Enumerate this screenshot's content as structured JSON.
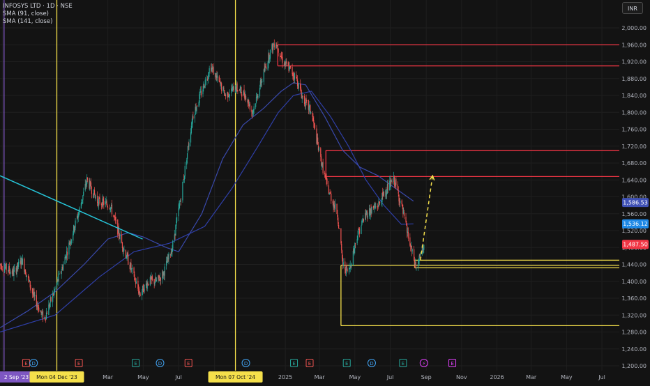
{
  "header": {
    "title": "INFOSYS LTD · 1D · NSE",
    "indicators": [
      "SMA (91, close)",
      "SMA (141, close)"
    ],
    "currency": "INR"
  },
  "colors": {
    "background": "#131313",
    "grid": "#1f1f1f",
    "up": "#26a69a",
    "down": "#ef5350",
    "sma91": "#3949ab",
    "sma141": "#2f3fa8",
    "trendline": "#26c6da",
    "resistance": "#f23645",
    "support": "#f5e04b",
    "vline_yellow": "#f5e04b",
    "vline_purple": "#7e57c2"
  },
  "chart_data": {
    "type": "candlestick",
    "ylim": [
      1190,
      2030
    ],
    "y_ticks": [
      1200,
      1240,
      1280,
      1320,
      1360,
      1400,
      1440,
      1480,
      1520,
      1560,
      1600,
      1640,
      1680,
      1720,
      1760,
      1800,
      1840,
      1880,
      1920,
      1960,
      2000
    ],
    "y_tick_labels": [
      "1,200.00",
      "1,240.00",
      "1,280.00",
      "1,320.00",
      "1,360.00",
      "1,400.00",
      "1,440.00",
      "1,480.00",
      "1,520.00",
      "1,560.00",
      "1,600.00",
      "1,640.00",
      "1,680.00",
      "1,720.00",
      "1,760.00",
      "1,800.00",
      "1,840.00",
      "1,880.00",
      "1,920.00",
      "1,960.00",
      "2,000.00"
    ],
    "x_axis": {
      "start": "2023-08-28",
      "end": "2026-07-31",
      "labels": [
        {
          "date": "2023-09-01",
          "text": "N"
        },
        {
          "date": "2024-03-01",
          "text": "Mar"
        },
        {
          "date": "2024-05-01",
          "text": "May"
        },
        {
          "date": "2024-07-01",
          "text": "Jul"
        },
        {
          "date": "2024-09-01",
          "text": "Se"
        },
        {
          "date": "2025-01-01",
          "text": "2025"
        },
        {
          "date": "2025-03-01",
          "text": "Mar"
        },
        {
          "date": "2025-05-01",
          "text": "May"
        },
        {
          "date": "2025-07-01",
          "text": "Jul"
        },
        {
          "date": "2025-09-01",
          "text": "Sep"
        },
        {
          "date": "2025-11-01",
          "text": "Nov"
        },
        {
          "date": "2026-01-01",
          "text": "2026"
        },
        {
          "date": "2026-03-01",
          "text": "Mar"
        },
        {
          "date": "2026-05-01",
          "text": "May"
        },
        {
          "date": "2026-07-01",
          "text": "Jul"
        }
      ]
    },
    "price_path": [
      [
        "2023-08-28",
        1440
      ],
      [
        "2023-09-20",
        1420
      ],
      [
        "2023-10-05",
        1450
      ],
      [
        "2023-10-26",
        1360
      ],
      [
        "2023-11-12",
        1310
      ],
      [
        "2023-11-28",
        1370
      ],
      [
        "2023-12-15",
        1440
      ],
      [
        "2024-01-10",
        1560
      ],
      [
        "2024-01-25",
        1640
      ],
      [
        "2024-02-12",
        1590
      ],
      [
        "2024-03-05",
        1580
      ],
      [
        "2024-03-25",
        1490
      ],
      [
        "2024-04-10",
        1430
      ],
      [
        "2024-04-25",
        1370
      ],
      [
        "2024-05-10",
        1400
      ],
      [
        "2024-05-25",
        1400
      ],
      [
        "2024-06-05",
        1420
      ],
      [
        "2024-06-20",
        1480
      ],
      [
        "2024-07-05",
        1600
      ],
      [
        "2024-07-25",
        1790
      ],
      [
        "2024-08-10",
        1850
      ],
      [
        "2024-08-25",
        1910
      ],
      [
        "2024-09-05",
        1880
      ],
      [
        "2024-09-20",
        1840
      ],
      [
        "2024-10-07",
        1860
      ],
      [
        "2024-10-25",
        1840
      ],
      [
        "2024-11-05",
        1800
      ],
      [
        "2024-11-20",
        1870
      ],
      [
        "2024-12-05",
        1940
      ],
      [
        "2024-12-15",
        1970
      ],
      [
        "2024-12-28",
        1920
      ],
      [
        "2025-01-10",
        1900
      ],
      [
        "2025-01-20",
        1880
      ],
      [
        "2025-02-01",
        1830
      ],
      [
        "2025-02-15",
        1800
      ],
      [
        "2025-03-01",
        1700
      ],
      [
        "2025-03-15",
        1620
      ],
      [
        "2025-04-01",
        1560
      ],
      [
        "2025-04-10",
        1440
      ],
      [
        "2025-04-20",
        1420
      ],
      [
        "2025-05-05",
        1510
      ],
      [
        "2025-05-20",
        1560
      ],
      [
        "2025-06-10",
        1580
      ],
      [
        "2025-06-25",
        1620
      ],
      [
        "2025-07-08",
        1640
      ],
      [
        "2025-07-20",
        1580
      ],
      [
        "2025-08-05",
        1480
      ],
      [
        "2025-08-15",
        1430
      ],
      [
        "2025-08-28",
        1487.5
      ]
    ],
    "sma_91": [
      [
        "2023-08-28",
        1290
      ],
      [
        "2023-10-15",
        1330
      ],
      [
        "2023-12-01",
        1375
      ],
      [
        "2024-01-20",
        1440
      ],
      [
        "2024-03-01",
        1500
      ],
      [
        "2024-04-05",
        1515
      ],
      [
        "2024-05-01",
        1505
      ],
      [
        "2024-06-10",
        1480
      ],
      [
        "2024-07-01",
        1470
      ],
      [
        "2024-08-10",
        1560
      ],
      [
        "2024-09-15",
        1690
      ],
      [
        "2024-10-20",
        1770
      ],
      [
        "2024-11-25",
        1810
      ],
      [
        "2024-12-25",
        1850
      ],
      [
        "2025-01-15",
        1870
      ],
      [
        "2025-02-05",
        1865
      ],
      [
        "2025-03-10",
        1790
      ],
      [
        "2025-04-10",
        1710
      ],
      [
        "2025-05-10",
        1670
      ],
      [
        "2025-06-10",
        1650
      ],
      [
        "2025-07-10",
        1620
      ],
      [
        "2025-08-10",
        1590
      ]
    ],
    "sma_141": [
      [
        "2023-08-28",
        1280
      ],
      [
        "2023-12-01",
        1320
      ],
      [
        "2024-02-15",
        1410
      ],
      [
        "2024-04-15",
        1470
      ],
      [
        "2024-06-15",
        1490
      ],
      [
        "2024-08-15",
        1530
      ],
      [
        "2024-10-01",
        1620
      ],
      [
        "2024-11-15",
        1720
      ],
      [
        "2024-12-20",
        1800
      ],
      [
        "2025-01-15",
        1840
      ],
      [
        "2025-02-15",
        1850
      ],
      [
        "2025-03-20",
        1790
      ],
      [
        "2025-04-20",
        1720
      ],
      [
        "2025-05-20",
        1640
      ],
      [
        "2025-06-20",
        1580
      ],
      [
        "2025-07-20",
        1535
      ],
      [
        "2025-08-10",
        1536
      ]
    ],
    "trendline": {
      "start": [
        "2023-08-28",
        1650
      ],
      "end": [
        "2024-04-30",
        1500
      ]
    },
    "resistance_zones": [
      {
        "start": "2024-12-19",
        "top": 1960,
        "bottom": 1910
      },
      {
        "start": "2025-03-12",
        "top": 1710,
        "bottom": 1648
      }
    ],
    "support_zones": [
      {
        "start": "2025-04-07",
        "top": 1438,
        "bottom": 1295
      },
      {
        "start": "2025-08-12",
        "top": 1450,
        "bottom": 1432
      }
    ],
    "projection": {
      "start": [
        "2025-08-22",
        1450
      ],
      "end": [
        "2025-09-12",
        1650
      ]
    },
    "vertical_lines": [
      {
        "date": "2023-09-04",
        "color": "purple"
      },
      {
        "date": "2023-12-04",
        "color": "yellow"
      },
      {
        "date": "2024-10-07",
        "color": "yellow"
      }
    ],
    "price_labels": [
      {
        "value": 1586.53,
        "text": "1,586.53",
        "color": "#3f51b5"
      },
      {
        "value": 1536.12,
        "text": "1,536.12",
        "color": "#1e88e5"
      },
      {
        "value": 1487.5,
        "text": "1,487.50",
        "color": "#f23645"
      }
    ],
    "date_labels": [
      {
        "date": "2023-09-04",
        "text": "2 Sep '23",
        "color": "purple"
      },
      {
        "date": "2023-12-04",
        "text": "Mon 04 Dec '23",
        "color": "yellow"
      },
      {
        "date": "2024-10-07",
        "text": "Mon 07 Oct '24",
        "color": "yellow"
      }
    ],
    "event_markers": [
      {
        "date": "2023-10-12",
        "kind": "E",
        "color": "#ef5350"
      },
      {
        "date": "2023-10-25",
        "kind": "D",
        "color": "#42a5f5"
      },
      {
        "date": "2024-01-11",
        "kind": "E",
        "color": "#ef5350"
      },
      {
        "date": "2024-04-18",
        "kind": "E",
        "color": "#26a69a"
      },
      {
        "date": "2024-05-30",
        "kind": "D",
        "color": "#42a5f5"
      },
      {
        "date": "2024-07-18",
        "kind": "E",
        "color": "#ef5350"
      },
      {
        "date": "2024-10-25",
        "kind": "D",
        "color": "#42a5f5"
      },
      {
        "date": "2025-01-16",
        "kind": "E",
        "color": "#26a69a"
      },
      {
        "date": "2025-02-12",
        "kind": "E",
        "color": "#ef5350"
      },
      {
        "date": "2025-04-17",
        "kind": "E",
        "color": "#26a69a"
      },
      {
        "date": "2025-05-30",
        "kind": "D",
        "color": "#42a5f5"
      },
      {
        "date": "2025-07-23",
        "kind": "E",
        "color": "#26a69a"
      },
      {
        "date": "2025-08-28",
        "kind": "⚡",
        "color": "#e040fb"
      },
      {
        "date": "2025-10-16",
        "kind": "E",
        "color": "#e040fb"
      }
    ]
  }
}
